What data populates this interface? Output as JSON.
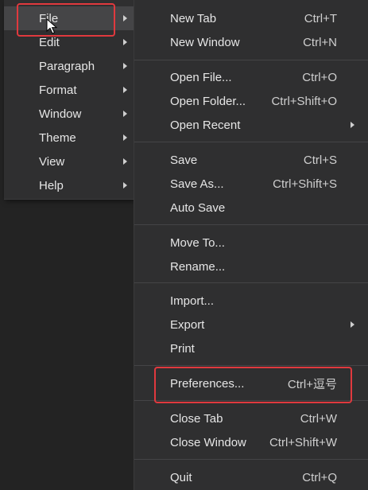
{
  "left_menu": [
    {
      "label": "File",
      "active": true
    },
    {
      "label": "Edit"
    },
    {
      "label": "Paragraph"
    },
    {
      "label": "Format"
    },
    {
      "label": "Window"
    },
    {
      "label": "Theme"
    },
    {
      "label": "View"
    },
    {
      "label": "Help"
    }
  ],
  "file_menu": {
    "new_tab": {
      "label": "New Tab",
      "shortcut": "Ctrl+T"
    },
    "new_window": {
      "label": "New Window",
      "shortcut": "Ctrl+N"
    },
    "open_file": {
      "label": "Open File...",
      "shortcut": "Ctrl+O"
    },
    "open_folder": {
      "label": "Open Folder...",
      "shortcut": "Ctrl+Shift+O"
    },
    "open_recent": {
      "label": "Open Recent"
    },
    "save": {
      "label": "Save",
      "shortcut": "Ctrl+S"
    },
    "save_as": {
      "label": "Save As...",
      "shortcut": "Ctrl+Shift+S"
    },
    "auto_save": {
      "label": "Auto Save"
    },
    "move_to": {
      "label": "Move To..."
    },
    "rename": {
      "label": "Rename..."
    },
    "import": {
      "label": "Import..."
    },
    "export": {
      "label": "Export"
    },
    "print": {
      "label": "Print"
    },
    "preferences": {
      "label": "Preferences...",
      "shortcut": "Ctrl+逗号"
    },
    "close_tab": {
      "label": "Close Tab",
      "shortcut": "Ctrl+W"
    },
    "close_window": {
      "label": "Close Window",
      "shortcut": "Ctrl+Shift+W"
    },
    "quit": {
      "label": "Quit",
      "shortcut": "Ctrl+Q"
    }
  },
  "highlight_color": "#e0393e"
}
